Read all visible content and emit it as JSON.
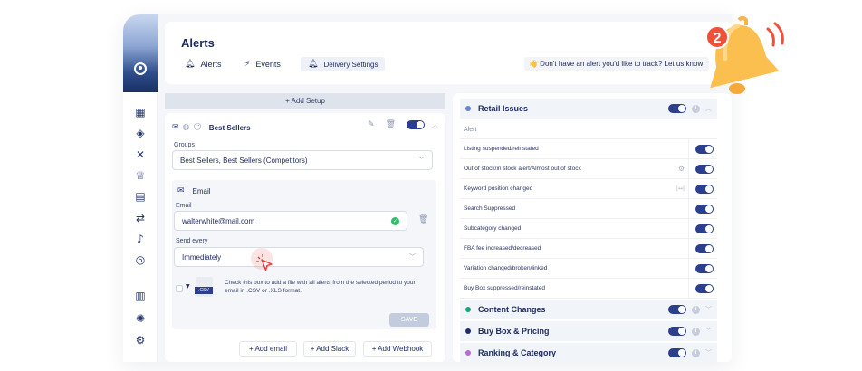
{
  "header": {
    "title": "Alerts",
    "tabs": [
      {
        "label": "Alerts",
        "icon": "bell-icon"
      },
      {
        "label": "Events",
        "icon": "bolt-icon"
      },
      {
        "label": "Delivery Settings",
        "icon": "bell-icon"
      }
    ],
    "tip": "👋 Don't have an alert you'd like to track? Let us know!"
  },
  "notification_badge": "2",
  "left": {
    "add_setup": "+ Add Setup",
    "card_title": "Best Sellers",
    "groups_label": "Groups",
    "groups_value": "Best Sellers, Best Sellers (Competitors)",
    "email_section_title": "Email",
    "email_label": "Email",
    "email_value": "walterwhite@mail.com",
    "send_every_label": "Send every",
    "send_every_value": "Immediately",
    "csv_label": ".CSV",
    "csv_text": "Check this box to add a file with all alerts from the selected period to your email in .CSV or .XLS format.",
    "save_label": "SAVE",
    "add_email": "+ Add email",
    "add_slack": "+ Add Slack",
    "add_webhook": "+ Add Webhook"
  },
  "right": {
    "sections": [
      {
        "title": "Retail Issues",
        "color": "#6a7fd6"
      },
      {
        "title": "Content Changes",
        "color": "#1fa382"
      },
      {
        "title": "Buy Box & Pricing",
        "color": "#1d2b6e"
      },
      {
        "title": "Ranking & Category",
        "color": "#b86ad6"
      }
    ],
    "table_header": "Alert",
    "rows": [
      "Listing suspended/reinstated",
      "Out of stock/in stock alert/Almost out of stock",
      "Keyword position changed",
      "Search Suppressed",
      "Subcategory changed",
      "FBA fee increased/decreased",
      "Variation changed/broken/linked",
      "Buy Box suppressed/reinstated"
    ]
  },
  "colors": {
    "accent": "#2b3f8c",
    "toggle_on": "#2b3f8c",
    "success": "#2bbf6a",
    "bell": "#f7b44a",
    "badge": "#f0503a"
  }
}
